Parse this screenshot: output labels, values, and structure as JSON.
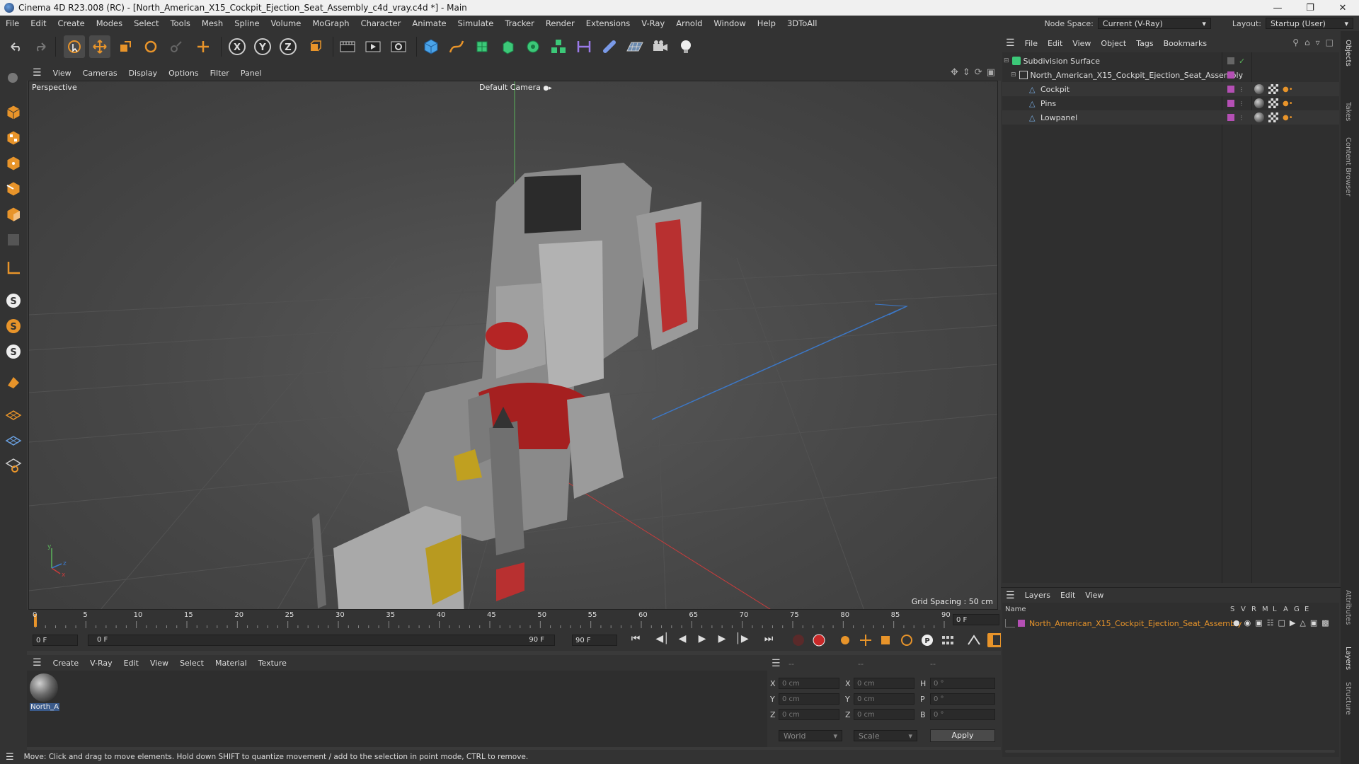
{
  "window": {
    "title": "Cinema 4D R23.008 (RC) - [North_American_X15_Cockpit_Ejection_Seat_Assembly_c4d_vray.c4d *] - Main"
  },
  "menubar": {
    "items": [
      "File",
      "Edit",
      "Create",
      "Modes",
      "Select",
      "Tools",
      "Mesh",
      "Spline",
      "Volume",
      "MoGraph",
      "Character",
      "Animate",
      "Simulate",
      "Tracker",
      "Render",
      "Extensions",
      "V-Ray",
      "Arnold",
      "Window",
      "Help",
      "3DToAll"
    ],
    "node_space_label": "Node Space:",
    "node_space_value": "Current (V-Ray)",
    "layout_label": "Layout:",
    "layout_value": "Startup (User)"
  },
  "viewport": {
    "menu": [
      "View",
      "Cameras",
      "Display",
      "Options",
      "Filter",
      "Panel"
    ],
    "view_name": "Perspective",
    "camera": "Default Camera",
    "grid_spacing": "Grid Spacing : 50 cm"
  },
  "timeline": {
    "ticks": [
      "0",
      "5",
      "10",
      "15",
      "20",
      "25",
      "30",
      "35",
      "40",
      "45",
      "50",
      "55",
      "60",
      "65",
      "70",
      "75",
      "80",
      "85",
      "90"
    ],
    "current_frame": "0 F",
    "start_field": "0 F",
    "range_start": "0 F",
    "range_end": "90 F",
    "end_field": "90 F"
  },
  "materials": {
    "menu": [
      "Create",
      "V-Ray",
      "Edit",
      "View",
      "Select",
      "Material",
      "Texture"
    ],
    "items": [
      {
        "label": "North_A"
      }
    ]
  },
  "coords": {
    "headers": [
      "--",
      "--",
      "--"
    ],
    "pos": [
      {
        "axis": "X",
        "value": "0 cm"
      },
      {
        "axis": "Y",
        "value": "0 cm"
      },
      {
        "axis": "Z",
        "value": "0 cm"
      }
    ],
    "size": [
      {
        "axis": "X",
        "value": "0 cm"
      },
      {
        "axis": "Y",
        "value": "0 cm"
      },
      {
        "axis": "Z",
        "value": "0 cm"
      }
    ],
    "rot": [
      {
        "axis": "H",
        "value": "0 °"
      },
      {
        "axis": "P",
        "value": "0 °"
      },
      {
        "axis": "B",
        "value": "0 °"
      }
    ],
    "mode1": "World",
    "mode2": "Scale",
    "apply": "Apply"
  },
  "objects": {
    "menu": [
      "File",
      "Edit",
      "View",
      "Object",
      "Tags",
      "Bookmarks"
    ],
    "rows": [
      {
        "name": "Subdivision Surface"
      },
      {
        "name": "North_American_X15_Cockpit_Ejection_Seat_Assembly"
      },
      {
        "name": "Cockpit"
      },
      {
        "name": "Pins"
      },
      {
        "name": "Lowpanel"
      }
    ]
  },
  "layers": {
    "menu": [
      "Layers",
      "Edit",
      "View"
    ],
    "header_name": "Name",
    "header_flags": [
      "S",
      "V",
      "R",
      "M",
      "L",
      "A",
      "G",
      "E"
    ],
    "rows": [
      {
        "name": "North_American_X15_Cockpit_Ejection_Seat_Assembly",
        "color": "#b44fb4"
      }
    ]
  },
  "side_tabs": [
    "Objects",
    "Takes",
    "Content Browser",
    "Attributes",
    "Layers",
    "Structure"
  ],
  "status": {
    "text": "Move: Click and drag to move elements. Hold down SHIFT to quantize movement / add to the selection in point mode, CTRL to remove."
  },
  "colors": {
    "accent_orange": "#e8942a",
    "layer_purple": "#b44fb4",
    "axis_red": "#c83c3c",
    "axis_blue": "#3c78c8",
    "axis_green": "#5ab45a"
  }
}
